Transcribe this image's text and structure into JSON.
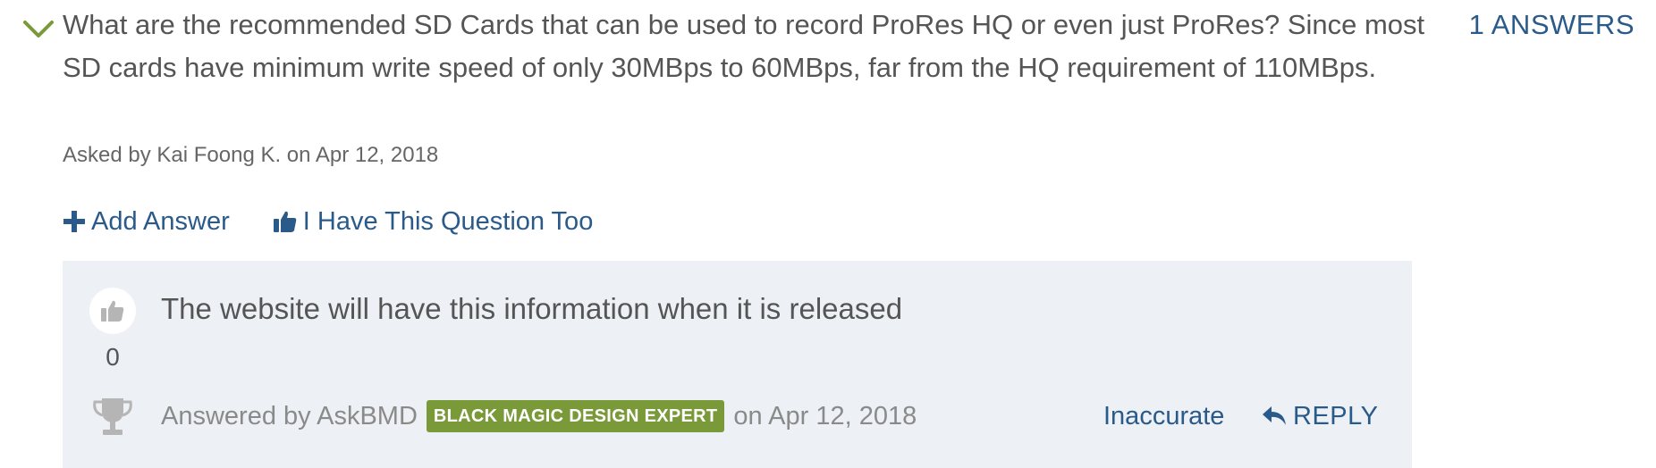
{
  "question": {
    "text": "What are the recommended SD Cards that can be used to record ProRes HQ or even just ProRes? Since most SD cards have minimum write speed of only 30MBps to 60MBps, far from the HQ requirement of 110MBps.",
    "asked_by": "Asked by Kai Foong K. on Apr 12, 2018",
    "answers_count": "1 ANSWERS",
    "expand_icon": "chevron-down-icon"
  },
  "actions": {
    "add_answer": "Add Answer",
    "same_question": "I Have This Question Too",
    "add_icon": "plus-icon",
    "thumb_icon": "thumbs-up-icon"
  },
  "answer": {
    "text": "The website will have this information when it is released",
    "votes": "0",
    "answered_by_prefix": "Answered by AskBMD",
    "badge": "BLACK MAGIC DESIGN EXPERT",
    "date": "on Apr 12, 2018",
    "inaccurate_label": "Inaccurate",
    "reply_label": "REPLY",
    "vote_icon": "thumbs-up-icon",
    "trophy_icon": "trophy-icon",
    "reply_icon": "reply-arrow-icon"
  },
  "colors": {
    "link": "#2a5a8a",
    "text": "#555555",
    "muted": "#8a8a8a",
    "answer_bg": "#edf0f4",
    "badge_bg": "#7a9a3a",
    "chevron": "#7a9a3a",
    "icon_gray": "#b5b5b5"
  }
}
